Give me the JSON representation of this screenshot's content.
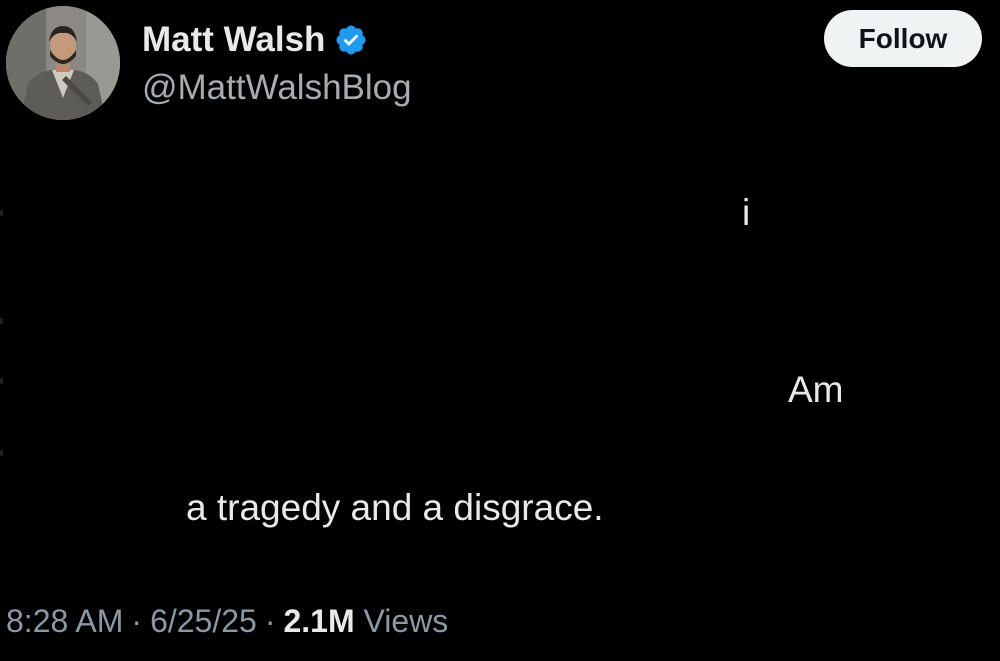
{
  "post": {
    "author": {
      "display_name": "Matt Walsh",
      "handle": "@MattWalshBlog",
      "verified_icon": "verified-badge-icon",
      "verified_color": "#1d9bf0"
    },
    "follow_label": "Follow",
    "text_fragments": {
      "fragment_1": "i",
      "fragment_2": "Am",
      "fragment_3": "a tragedy and a disgrace."
    },
    "meta": {
      "time": "8:28 AM",
      "date": "6/25/25",
      "separator": "·",
      "views_count": "2.1M",
      "views_label": "Views"
    }
  },
  "colors": {
    "background": "#000000",
    "primary_text": "#e7e9ea",
    "secondary_text": "#8b98a5",
    "follow_button_bg": "#eff3f4",
    "follow_button_text": "#0f1419"
  }
}
